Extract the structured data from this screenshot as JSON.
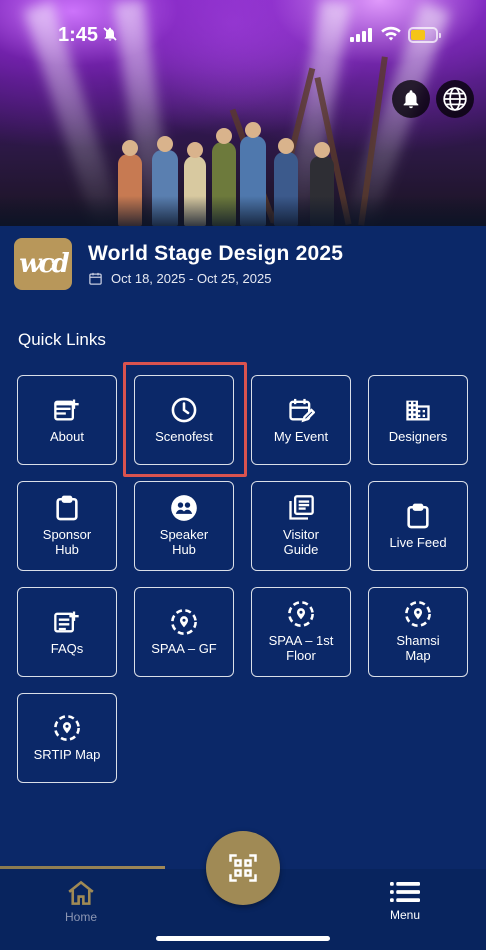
{
  "status_bar": {
    "time": "1:45",
    "battery_color": "#f5c518"
  },
  "hero": {
    "description_icons": [
      "bell-icon",
      "globe-icon"
    ]
  },
  "event": {
    "logo_text": "wcd",
    "title": "World Stage Design 2025",
    "dates": "Oct 18, 2025 - Oct 25, 2025"
  },
  "quick_links": {
    "heading": "Quick Links",
    "items": [
      {
        "label": "About",
        "icon": "note-add-icon"
      },
      {
        "label": "Scenofest",
        "icon": "clock-icon"
      },
      {
        "label": "My Event",
        "icon": "calendar-edit-icon"
      },
      {
        "label": "Designers",
        "icon": "building-icon"
      },
      {
        "label": "Sponsor\nHub",
        "icon": "clipboard-icon"
      },
      {
        "label": "Speaker\nHub",
        "icon": "group-icon"
      },
      {
        "label": "Visitor\nGuide",
        "icon": "library-books-icon"
      },
      {
        "label": "Live Feed",
        "icon": "clipboard-icon"
      },
      {
        "label": "FAQs",
        "icon": "note-add-icon"
      },
      {
        "label": "SPAA – GF",
        "icon": "location-pin-icon"
      },
      {
        "label": "SPAA – 1st\nFloor",
        "icon": "location-pin-icon"
      },
      {
        "label": "Shamsi\nMap",
        "icon": "location-pin-icon"
      },
      {
        "label": "SRTIP Map",
        "icon": "location-pin-icon"
      }
    ]
  },
  "bottom_nav": {
    "home_label": "Home",
    "menu_label": "Menu",
    "accent_color": "#a08a55"
  },
  "colors": {
    "background": "#0b2868",
    "highlight": "#d9534f"
  }
}
